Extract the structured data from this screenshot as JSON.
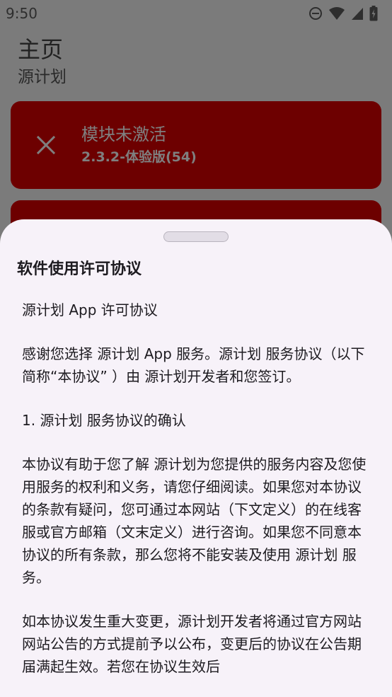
{
  "status_bar": {
    "time": "9:50",
    "icons": [
      "do-not-disturb-icon",
      "wifi-icon",
      "signal-icon",
      "battery-icon"
    ]
  },
  "header": {
    "title": "主页",
    "subtitle": "源计划"
  },
  "module_card": {
    "status": "模块未激活",
    "version": "2.3.2-体验版(54)",
    "icon": "close-icon",
    "color": "#6d0000"
  },
  "sheet": {
    "title": "软件使用许可协议",
    "paragraphs": [
      "源计划 App 许可协议",
      "感谢您选择 源计划 App 服务。源计划 服务协议（以下简称“本协议” ）由 源计划开发者和您签订。",
      "1. 源计划 服务协议的确认",
      "本协议有助于您了解 源计划为您提供的服务内容及您使用服务的权利和义务，请您仔细阅读。如果您对本协议的条款有疑问，您可通过本网站（下文定义）的在线客服或官方邮箱（文末定义）进行咨询。如果您不同意本协议的所有条款，那么您将不能安装及使用 源计划 服务。",
      "如本协议发生重大变更，源计划开发者将通过官方网站网站公告的方式提前予以公布，变更后的协议在公告期届满起生效。若您在协议生效后"
    ]
  }
}
